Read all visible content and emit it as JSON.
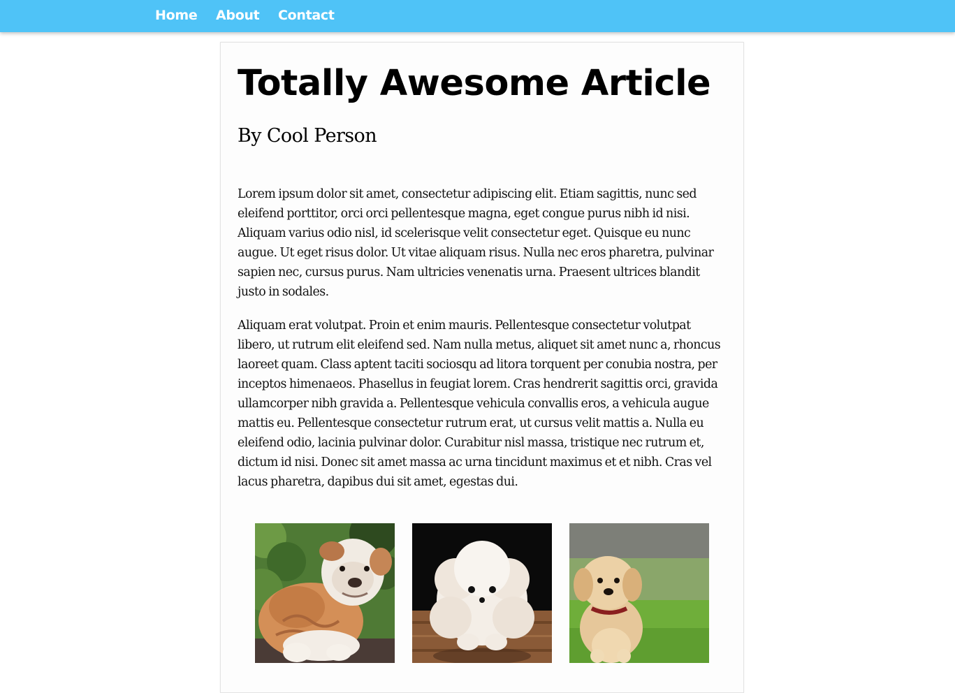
{
  "nav": {
    "home_label": "Home",
    "about_label": "About",
    "contact_label": "Contact",
    "bar_color": "#4fc3f7"
  },
  "article": {
    "title": "Totally Awesome Article",
    "byline": "By Cool Person",
    "paragraphs": [
      "Lorem ipsum dolor sit amet, consectetur adipiscing elit. Etiam sagittis, nunc sed eleifend porttitor, orci orci pellentesque magna, eget congue purus nibh id nisi. Aliquam varius odio nisl, id scelerisque velit consectetur eget. Quisque eu nunc augue. Ut eget risus dolor. Ut vitae aliquam risus. Nulla nec eros pharetra, pulvinar sapien nec, cursus purus. Nam ultricies venenatis urna. Praesent ultrices blandit justo in sodales.",
      "Aliquam erat volutpat. Proin et enim mauris. Pellentesque consectetur volutpat libero, ut rutrum elit eleifend sed. Nam nulla metus, aliquet sit amet nunc a, rhoncus laoreet quam. Class aptent taciti sociosqu ad litora torquent per conubia nostra, per inceptos himenaeos. Phasellus in feugiat lorem. Cras hendrerit sagittis orci, gravida ullamcorper nibh gravida a. Pellentesque vehicula convallis eros, a vehicula augue mattis eu. Pellentesque consectetur rutrum erat, ut cursus velit mattis a. Nulla eu eleifend odio, lacinia pulvinar dolor. Curabitur nisl massa, tristique nec rutrum et, dictum id nisi. Donec sit amet massa ac urna tincidunt maximus et et nibh. Cras vel lacus pharetra, dapibus dui sit amet, egestas dui."
    ]
  },
  "gallery": {
    "images": [
      {
        "subject": "bulldog-puppy"
      },
      {
        "subject": "pomeranian-puppy"
      },
      {
        "subject": "golden-retriever-puppy"
      }
    ]
  }
}
